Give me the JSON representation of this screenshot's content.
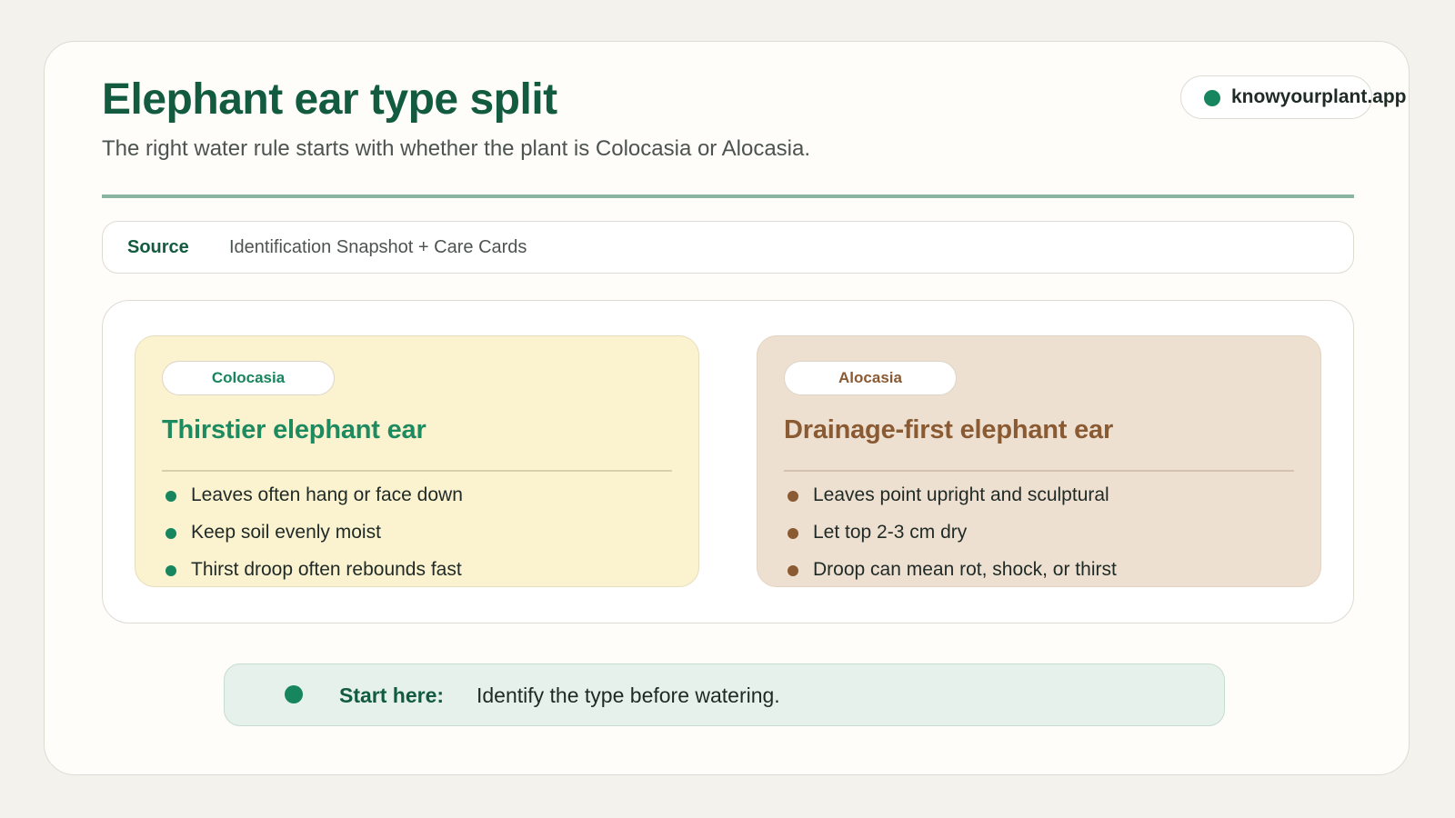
{
  "header": {
    "title": "Elephant ear type split",
    "subtitle": "The right water rule starts with whether the plant is Colocasia or Alocasia.",
    "brand": "knowyourplant.app"
  },
  "source": {
    "label": "Source",
    "value": "Identification Snapshot + Care Cards"
  },
  "cards": [
    {
      "tag": "Colocasia",
      "heading": "Thirstier elephant ear",
      "accent_color": "#1d8a5f",
      "background_color": "#fbf2d0",
      "bullets": [
        "Leaves often hang or face down",
        "Keep soil evenly moist",
        "Thirst droop often rebounds fast"
      ]
    },
    {
      "tag": "Alocasia",
      "heading": "Drainage-first elephant ear",
      "accent_color": "#8a5a33",
      "background_color": "#eee0d1",
      "bullets": [
        "Leaves point upright and sculptural",
        "Let top 2-3 cm dry",
        "Droop can mean rot, shock, or thirst"
      ]
    }
  ],
  "callout": {
    "label": "Start here:",
    "text": "Identify the type before watering.",
    "background_color": "#e6f1eb"
  },
  "colors": {
    "page_background": "#f4f2ec",
    "primary_green": "#135b40",
    "brand_dot": "#17855d",
    "rule": "#89b6a2"
  }
}
